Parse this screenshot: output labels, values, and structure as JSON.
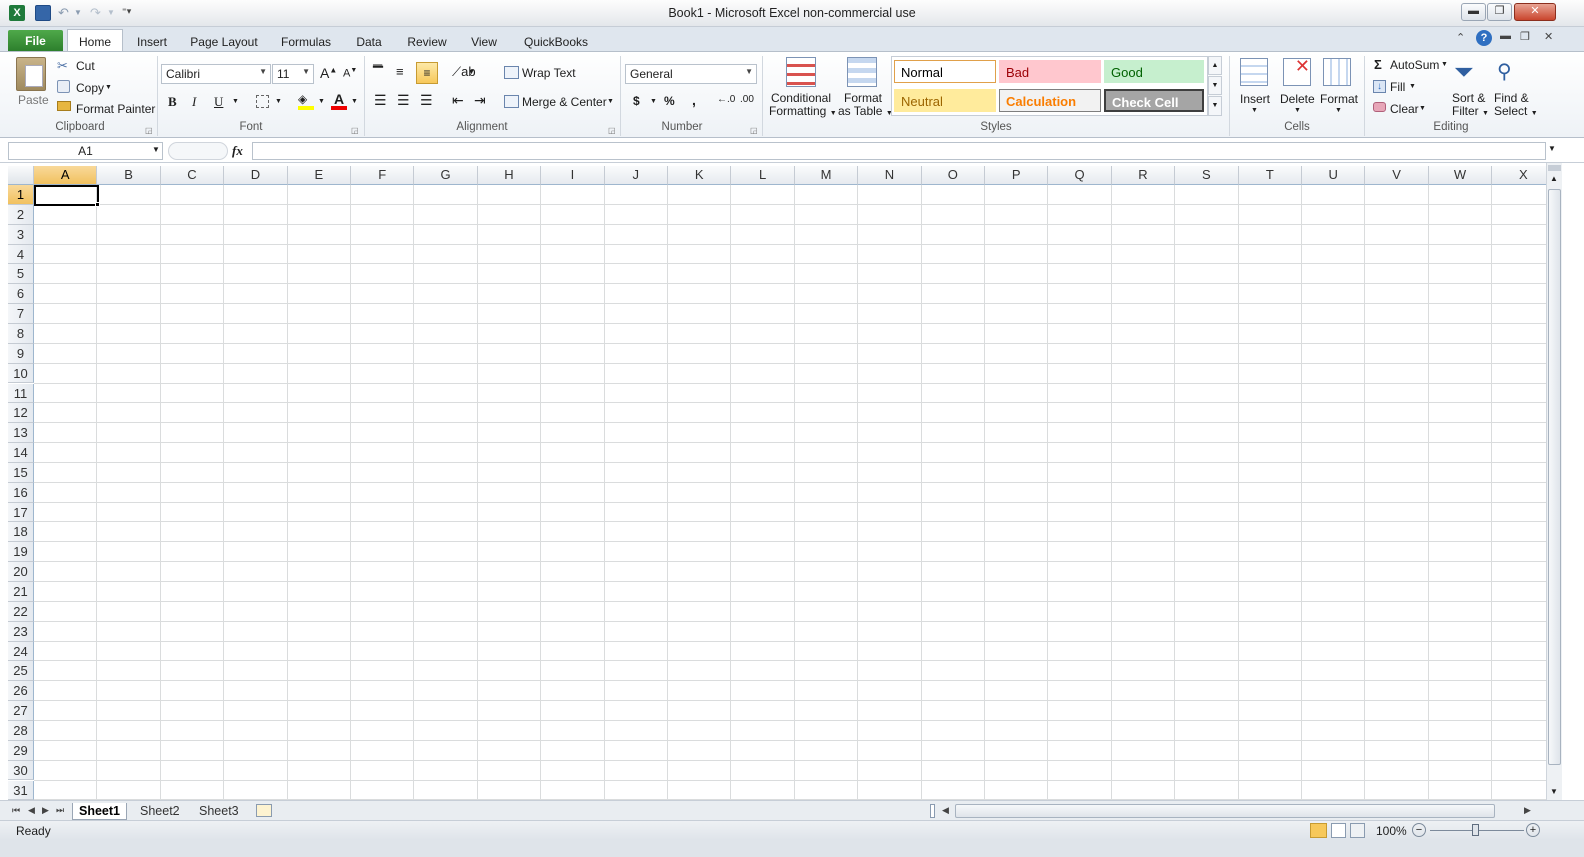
{
  "window": {
    "title": "Book1  -  Microsoft Excel non-commercial use",
    "qat_icons": [
      "excel-logo-icon",
      "save-icon",
      "undo-icon",
      "redo-icon",
      "customize-qat-icon"
    ],
    "controls": {
      "minimize": "▬",
      "restore": "❐",
      "close": "✕"
    }
  },
  "tabs": {
    "file": "File",
    "items": [
      "Home",
      "Insert",
      "Page Layout",
      "Formulas",
      "Data",
      "Review",
      "View",
      "QuickBooks"
    ],
    "active": "Home"
  },
  "ribbon": {
    "clipboard": {
      "label": "Clipboard",
      "paste": "Paste",
      "cut": "Cut",
      "copy": "Copy",
      "format_painter": "Format Painter"
    },
    "font": {
      "label": "Font",
      "font_name": "Calibri",
      "font_size": "11",
      "bold": "B",
      "italic": "I",
      "underline": "U",
      "grow": "A",
      "shrink": "A"
    },
    "alignment": {
      "label": "Alignment",
      "wrap_text": "Wrap Text",
      "merge_center": "Merge & Center"
    },
    "number": {
      "label": "Number",
      "format": "General",
      "currency": "$",
      "percent": "%",
      "comma": ","
    },
    "styles": {
      "label": "Styles",
      "conditional_1": "Conditional",
      "conditional_2": "Formatting",
      "format_table_1": "Format",
      "format_table_2": "as Table",
      "gallery": [
        {
          "name": "Normal",
          "fg": "#000000",
          "bg": "#ffffff",
          "border": "#e0a04a"
        },
        {
          "name": "Bad",
          "fg": "#9c0006",
          "bg": "#ffc7ce",
          "border": "#ffc7ce"
        },
        {
          "name": "Good",
          "fg": "#006100",
          "bg": "#c6efce",
          "border": "#c6efce"
        },
        {
          "name": "Neutral",
          "fg": "#9c6500",
          "bg": "#ffeb9c",
          "border": "#ffeb9c"
        },
        {
          "name": "Calculation",
          "fg": "#fa7d00",
          "bg": "#f2f2f2",
          "border": "#7f7f7f"
        },
        {
          "name": "Check Cell",
          "fg": "#ffffff",
          "bg": "#a5a5a5",
          "border": "#3f3f3f"
        }
      ]
    },
    "cells": {
      "label": "Cells",
      "insert": "Insert",
      "delete": "Delete",
      "format": "Format"
    },
    "editing": {
      "label": "Editing",
      "autosum": "AutoSum",
      "fill": "Fill",
      "clear": "Clear",
      "sort_1": "Sort &",
      "sort_2": "Filter",
      "find_1": "Find &",
      "find_2": "Select"
    }
  },
  "formula_bar": {
    "name_box": "A1",
    "fx": "fx",
    "value": ""
  },
  "sheet": {
    "columns": [
      "A",
      "B",
      "C",
      "D",
      "E",
      "F",
      "G",
      "H",
      "I",
      "J",
      "K",
      "L",
      "M",
      "N",
      "O",
      "P",
      "Q",
      "R",
      "S",
      "T",
      "U",
      "V",
      "W",
      "X"
    ],
    "rows": [
      "1",
      "2",
      "3",
      "4",
      "5",
      "6",
      "7",
      "8",
      "9",
      "10",
      "11",
      "12",
      "13",
      "14",
      "15",
      "16",
      "17",
      "18",
      "19",
      "20",
      "21",
      "22",
      "23",
      "24",
      "25",
      "26",
      "27",
      "28",
      "29",
      "30",
      "31"
    ],
    "selected_col": "A",
    "selected_row": "1"
  },
  "sheet_tabs": [
    "Sheet1",
    "Sheet2",
    "Sheet3"
  ],
  "active_sheet": "Sheet1",
  "status": {
    "text": "Ready",
    "zoom": "100%"
  },
  "colors": {
    "accent": "#2b7d2b",
    "selection": "#f1c15f",
    "grid": "#dadcdd"
  }
}
